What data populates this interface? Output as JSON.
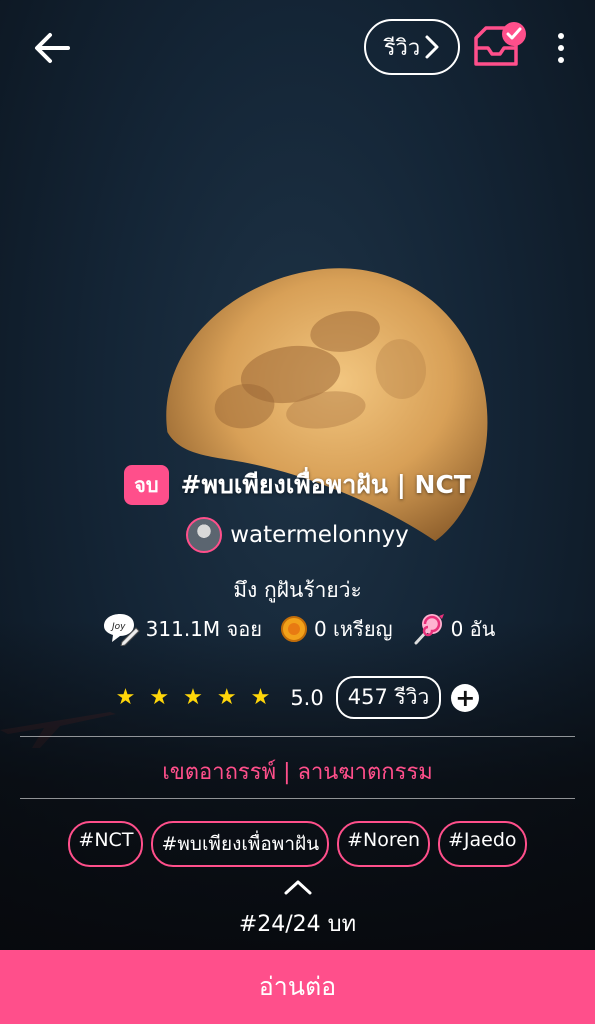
{
  "header": {
    "review_label": "รีวิว"
  },
  "story": {
    "status": "จบ",
    "title": "#พบเพียงเพื่อพาฝัน | NCT",
    "author": "watermelonnyy",
    "tagline": "มึง กูฝันร้ายว่ะ"
  },
  "stats": {
    "views": "311.1M จอย",
    "coins": "0 เหรียญ",
    "candies": "0 อัน"
  },
  "rating": {
    "stars": 5,
    "score": "5.0",
    "reviews": "457 รีวิว"
  },
  "category": "เขตอาถรรพ์ | ลานฆาตกรรม",
  "tags": [
    "#NCT",
    "#พบเพียงเพื่อพาฝัน",
    "#Noren",
    "#Jaedo"
  ],
  "episode": "#24/24 บท",
  "read_button": "อ่านต่อ",
  "colors": {
    "accent": "#ff4f8b",
    "star": "#ffd60a"
  }
}
